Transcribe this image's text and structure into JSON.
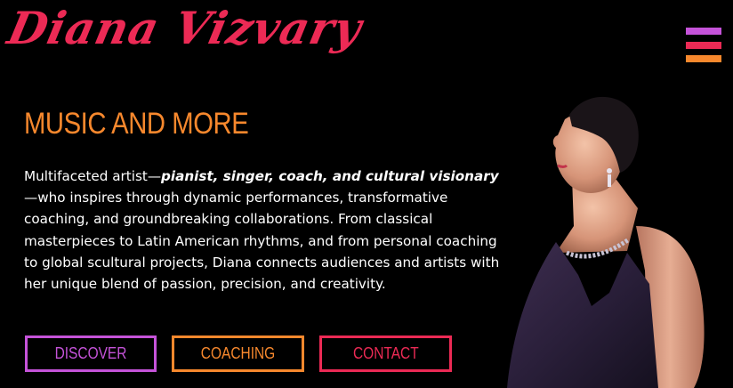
{
  "brand": {
    "name": "Diana Vizvary",
    "color": "#ec2a55"
  },
  "menu": {
    "icon": "hamburger-menu-icon",
    "colors": [
      "#c553d9",
      "#ec2a55",
      "#f7882d"
    ]
  },
  "hero": {
    "heading": "MUSIC AND MORE",
    "bio": {
      "intro": "Multifaceted artist—",
      "emphasis": "pianist, singer, coach, and cultural visionary",
      "rest": "—who inspires through dynamic performances, transformative coaching, and groundbreaking collaborations. From classical masterpieces to Latin American rhythms, and from personal coaching to global scultural projects, Diana connects audiences and artists with her unique blend of passion, precision, and creativity."
    }
  },
  "buttons": [
    {
      "label": "DISCOVER",
      "color": "#c553d9"
    },
    {
      "label": "COACHING",
      "color": "#f7882d"
    },
    {
      "label": "CONTACT",
      "color": "#ec2a55"
    }
  ],
  "portrait": {
    "subject": "woman in profile wearing dark purple halter dress with jeweled neckline"
  }
}
